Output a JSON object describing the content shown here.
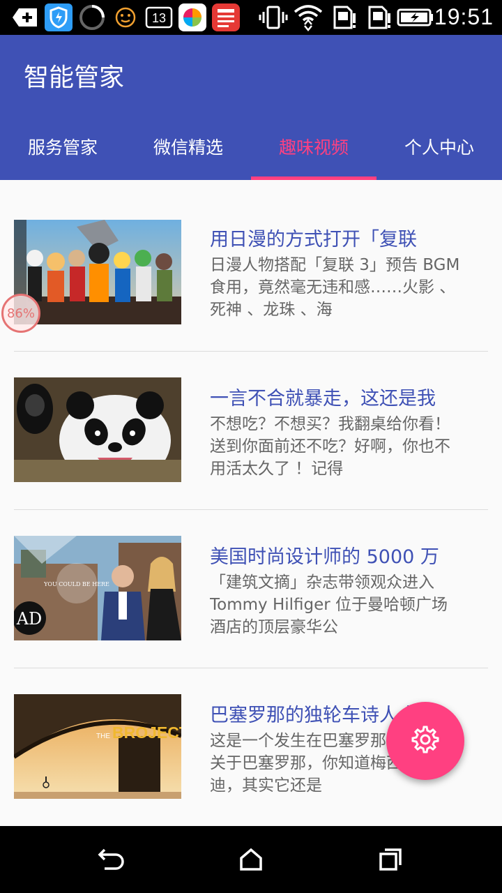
{
  "status_bar": {
    "time": "19:51",
    "notification_count": "13",
    "icons": [
      "add-notification-icon",
      "shield-icon",
      "loading-ring-icon",
      "smiley-icon",
      "message-count-icon",
      "app-store-icon",
      "news-app-icon",
      "vibrate-icon",
      "wifi-icon",
      "sim-1-icon",
      "sim-2-icon",
      "battery-charging-icon"
    ]
  },
  "app_bar": {
    "title": "智能管家"
  },
  "tabs": [
    {
      "label": "服务管家",
      "active": false
    },
    {
      "label": "微信精选",
      "active": false
    },
    {
      "label": "趣味视频",
      "active": true
    },
    {
      "label": "个人中心",
      "active": false
    }
  ],
  "progress_badge": "86%",
  "list": [
    {
      "title": "用日漫的方式打开「复联",
      "desc": "日漫人物搭配「复联 3」预告 BGM 食用，竟然毫无违和感……火影 、死神 、龙珠 、海",
      "thumb": "anime-characters-image"
    },
    {
      "title": "一言不合就暴走，这还是我",
      "desc": "不想吃？不想买？我翻桌给你看！送到你面前还不吃？好啊，你也不用活太久了 ！记得",
      "thumb": "panda-image"
    },
    {
      "title": "美国时尚设计师的 5000 万",
      "desc": "「建筑文摘」杂志带领观众进入 Tommy Hilfiger 位于曼哈顿广场酒店的顶层豪华公",
      "thumb": "designer-portrait-image",
      "thumb_logo": "AD",
      "thumb_badge": "YOU COULD BE HERE"
    },
    {
      "title": "巴塞罗那的独轮车诗人 把",
      "desc": "这是一个发生在巴塞罗那的故事。关于巴塞罗那，你知道梅西或者高迪，其实它还是",
      "thumb": "bridge-unicycle-image",
      "thumb_text": "BROJECT",
      "thumb_text_prefix": "THE"
    }
  ],
  "fab": {
    "icon": "settings-gear-icon"
  },
  "nav_bar": {
    "icons": [
      "back-icon",
      "home-icon",
      "recents-icon"
    ]
  },
  "colors": {
    "primary": "#3f51b5",
    "accent": "#ff4081",
    "title_text": "#3f51b5",
    "desc_text": "#666666"
  }
}
